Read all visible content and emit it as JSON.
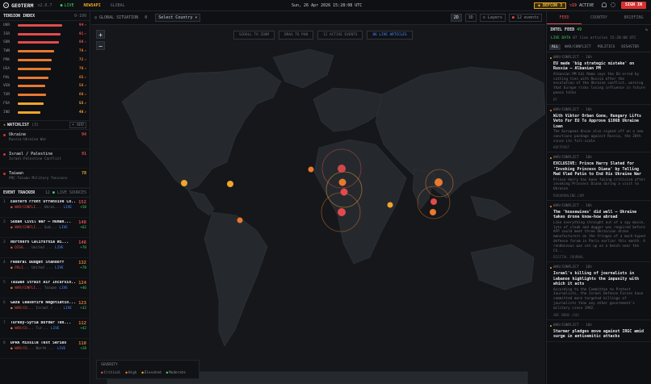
{
  "header": {
    "app_name": "GEOTERM",
    "version": "v2.0.7",
    "live_label": "LIVE",
    "newsapi_label": "NEWSAPI",
    "global_label": "GLOBAL",
    "datetime": "Sun, 26 Apr 2026 15:28:08 UTC",
    "defcon_label": "DEFCON 3",
    "active_count": "19",
    "active_label": "ACTIVE",
    "sign_in": "SIGN IN"
  },
  "tension": {
    "title": "TENSION INDEX",
    "subtitle": "0-100",
    "rows": [
      {
        "code": "UKR",
        "value": 94,
        "color": "#e14b4b"
      },
      {
        "code": "ISR",
        "value": 91,
        "color": "#e14b4b"
      },
      {
        "code": "SDN",
        "value": 88,
        "color": "#e14b4b"
      },
      {
        "code": "TWN",
        "value": 78,
        "color": "#e8792e"
      },
      {
        "code": "PRK",
        "value": 72,
        "color": "#e8792e"
      },
      {
        "code": "USA",
        "value": 70,
        "color": "#e8792e"
      },
      {
        "code": "PHL",
        "value": 65,
        "color": "#e8792e"
      },
      {
        "code": "VEN",
        "value": 58,
        "color": "#e8792e"
      },
      {
        "code": "TUR",
        "value": 60,
        "color": "#e8792e"
      },
      {
        "code": "FRA",
        "value": 55,
        "color": "#f0a52a"
      },
      {
        "code": "IND",
        "value": 48,
        "color": "#f0a52a"
      }
    ]
  },
  "watchlist": {
    "title": "WATCHLIST",
    "count": "(3)",
    "add_label": "+ ADD",
    "items": [
      {
        "title": "Ukraine",
        "sub": "Russia-Ukraine War",
        "value": "94",
        "color": "#e14b4b"
      },
      {
        "title": "Israel / Palestine",
        "sub": "Israel-Palestine Conflict",
        "value": "91",
        "color": "#e14b4b"
      },
      {
        "title": "Taiwan",
        "sub": "PRC-Taiwan Military Tensions",
        "value": "78",
        "color": "#f0a52a"
      }
    ]
  },
  "events": {
    "title": "EVENT TRACKER",
    "count": "12",
    "live_label": "LIVE SOURCES",
    "items": [
      {
        "n": "1",
        "title": "Eastern Front Offensive Co...",
        "cat": "WAR/CONFLI...",
        "loc": "Ukrai...",
        "lv": "LIVE",
        "score": "152",
        "delta": "+58",
        "color": "#e14b4b"
      },
      {
        "n": "2",
        "title": "Sudan Civil War — Human...",
        "cat": "WAR/CONFLI...",
        "loc": "Sud...",
        "lv": "LIVE",
        "score": "148",
        "delta": "+62",
        "color": "#e14b4b"
      },
      {
        "n": "3",
        "title": "Northern California Wi...",
        "cat": "DISA...",
        "loc": "United ...",
        "lv": "LIVE",
        "score": "148",
        "delta": "+70",
        "color": "#e14b4b"
      },
      {
        "n": "4",
        "title": "Federal Budget Standoff",
        "cat": "POLI...",
        "loc": "United ...",
        "lv": "LIVE",
        "score": "132",
        "delta": "+70",
        "color": "#e8792e"
      },
      {
        "n": "5",
        "title": "Taiwan Strait Air Incursio...",
        "cat": "WAR/CONFLI...",
        "loc": "Taiwan",
        "lv": "LIVE",
        "score": "124",
        "delta": "+46",
        "color": "#e8792e"
      },
      {
        "n": "6",
        "title": "Gaza Ceasefire Negotiatio...",
        "cat": "WAR/CO...",
        "loc": "Israel / ...",
        "lv": "LIVE",
        "score": "123",
        "delta": "+32",
        "color": "#e8792e"
      },
      {
        "n": "7",
        "title": "Turkey-Syria Border Ten...",
        "cat": "WAR/CO...",
        "loc": "Tur...",
        "lv": "LIVE",
        "score": "112",
        "delta": "+42",
        "color": "#e8792e"
      },
      {
        "n": "8",
        "title": "DPRK Missile Test Series",
        "cat": "WAR/CO...",
        "loc": "North ...",
        "lv": "LIVE",
        "score": "118",
        "delta": "+28",
        "color": "#e8792e"
      }
    ]
  },
  "map": {
    "global_label": "GLOBAL SITUATION",
    "count": "0",
    "select_country": "Select Country",
    "view_2d": "2D",
    "view_3d": "3D",
    "layers_label": "Layers",
    "events_label": "12 events",
    "zoom_in": "+",
    "zoom_out": "−",
    "chips": [
      "SCROLL TO ZOOM",
      "DRAG TO PAN",
      "12 ACTIVE EVENTS",
      "86 LIVE ARTICLES"
    ],
    "severity_title": "SEVERITY",
    "severity": [
      {
        "label": "Critical",
        "color": "#e14b4b"
      },
      {
        "label": "High",
        "color": "#e8792e"
      },
      {
        "label": "Elevated",
        "color": "#f0a52a"
      },
      {
        "label": "Moderate",
        "color": "#3ecf5f"
      }
    ]
  },
  "right": {
    "tabs": [
      "FEED",
      "COUNTRY",
      "BRIEFING"
    ],
    "intel_title": "INTEL FEED",
    "intel_count": "49",
    "live_data": "LIVE DATA",
    "live_data_sub": "87 live articles 15:28:08 UTC",
    "filters": [
      "ALL",
      "WAR/CONFLICT",
      "POLITICS",
      "DISASTER"
    ],
    "items": [
      {
        "cat": "WAR/CONFLICT",
        "ago": "· 16h",
        "title": "EU made 'big strategic mistake' on Russia — Albanian PM",
        "desc": "Albanian PM Edi Rama says the EU erred by cutting ties with Russia after the escalation of the Ukraine conflict, warning that Europe risks losing influence in future peace talks",
        "src": "RT"
      },
      {
        "cat": "WAR/CONFLICT",
        "ago": "· 16h",
        "title": "With Viktor Orban Gone, Hungary Lifts Veto For EU To Approve $106B Ukraine Loan",
        "desc": "The European Union also signed off on a new sanctions package against Russia, the 20th since its full-scale",
        "src": "HUFFPOST"
      },
      {
        "cat": "WAR/CONFLICT",
        "ago": "· 16h",
        "title": "EXCLUSIVE: Prince Harry Slated for 'Invoking Princess Diana' by Telling Mad Vlad Putin to End His Ukraine War",
        "desc": "Prince Harry has been facing criticism after invoking Princess Diana during a visit to Ukraine",
        "src": "RADARONLINE.COM"
      },
      {
        "cat": "WAR/CONFLICT",
        "ago": "· 16h",
        "title": "The 'housewives' did well — Ukraine takes drone know-how abroad",
        "desc": "Like everything straight out of a spy movie, lots of cloak and dagger was required before AFP could meet three Ukrainian drone manufacturers on the fringes of a much-hyped defence forum in Paris earlier this month. A rendezvous was set up on a bench near the Ch...",
        "src": "DIGITAL JOURNAL"
      },
      {
        "cat": "WAR/CONFLICT",
        "ago": "· 16h",
        "title": "Israel's killing of journalists in Lebanon highlights the impunity with which it acts",
        "desc": "According to the Committee to Protect Journalists, the Israel Defense Forces have committed more targeted killings of journalists than any other government's military since 1992.",
        "src": "ABC NEWS (AU)"
      },
      {
        "cat": "WAR/CONFLICT",
        "ago": "· 16h",
        "title": "Starmer pledges move against IRGC amid surge in antisemitic attacks",
        "desc": "",
        "src": ""
      }
    ]
  }
}
